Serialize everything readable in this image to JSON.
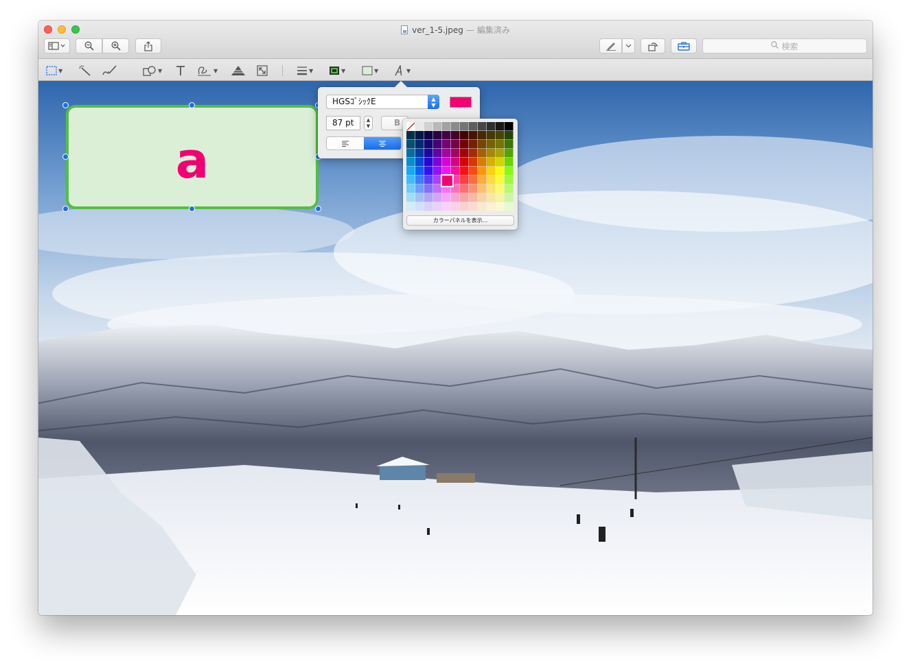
{
  "window": {
    "filename": "ver_1-5.jpeg",
    "separator": "—",
    "edited_label": "編集済み"
  },
  "toolbar": {
    "search_placeholder": "検索",
    "buttons": [
      "sidebar-toggle",
      "zoom-out",
      "zoom-in",
      "share",
      "markup",
      "markup-menu",
      "rotate",
      "toolbox"
    ]
  },
  "markup_tools": [
    "rectangular-selection",
    "instant-alpha",
    "sketch",
    "shapes",
    "text",
    "sign",
    "adjust-color",
    "adjust-size",
    "shape-style",
    "border-color",
    "fill-color",
    "text-style"
  ],
  "shape": {
    "text": "a",
    "fill_color": "#dbefd6",
    "border_color": "#55bd45",
    "text_color": "#f10074"
  },
  "font_popover": {
    "font_name": "HGSｺﾞｼｯｸE",
    "size": "87 pt",
    "bold_label": "B",
    "text_color": "#f40072",
    "alignment": "center"
  },
  "color_palette": {
    "show_panel_button": "カラーパネルを表示...",
    "selected_color": "#f40072"
  }
}
